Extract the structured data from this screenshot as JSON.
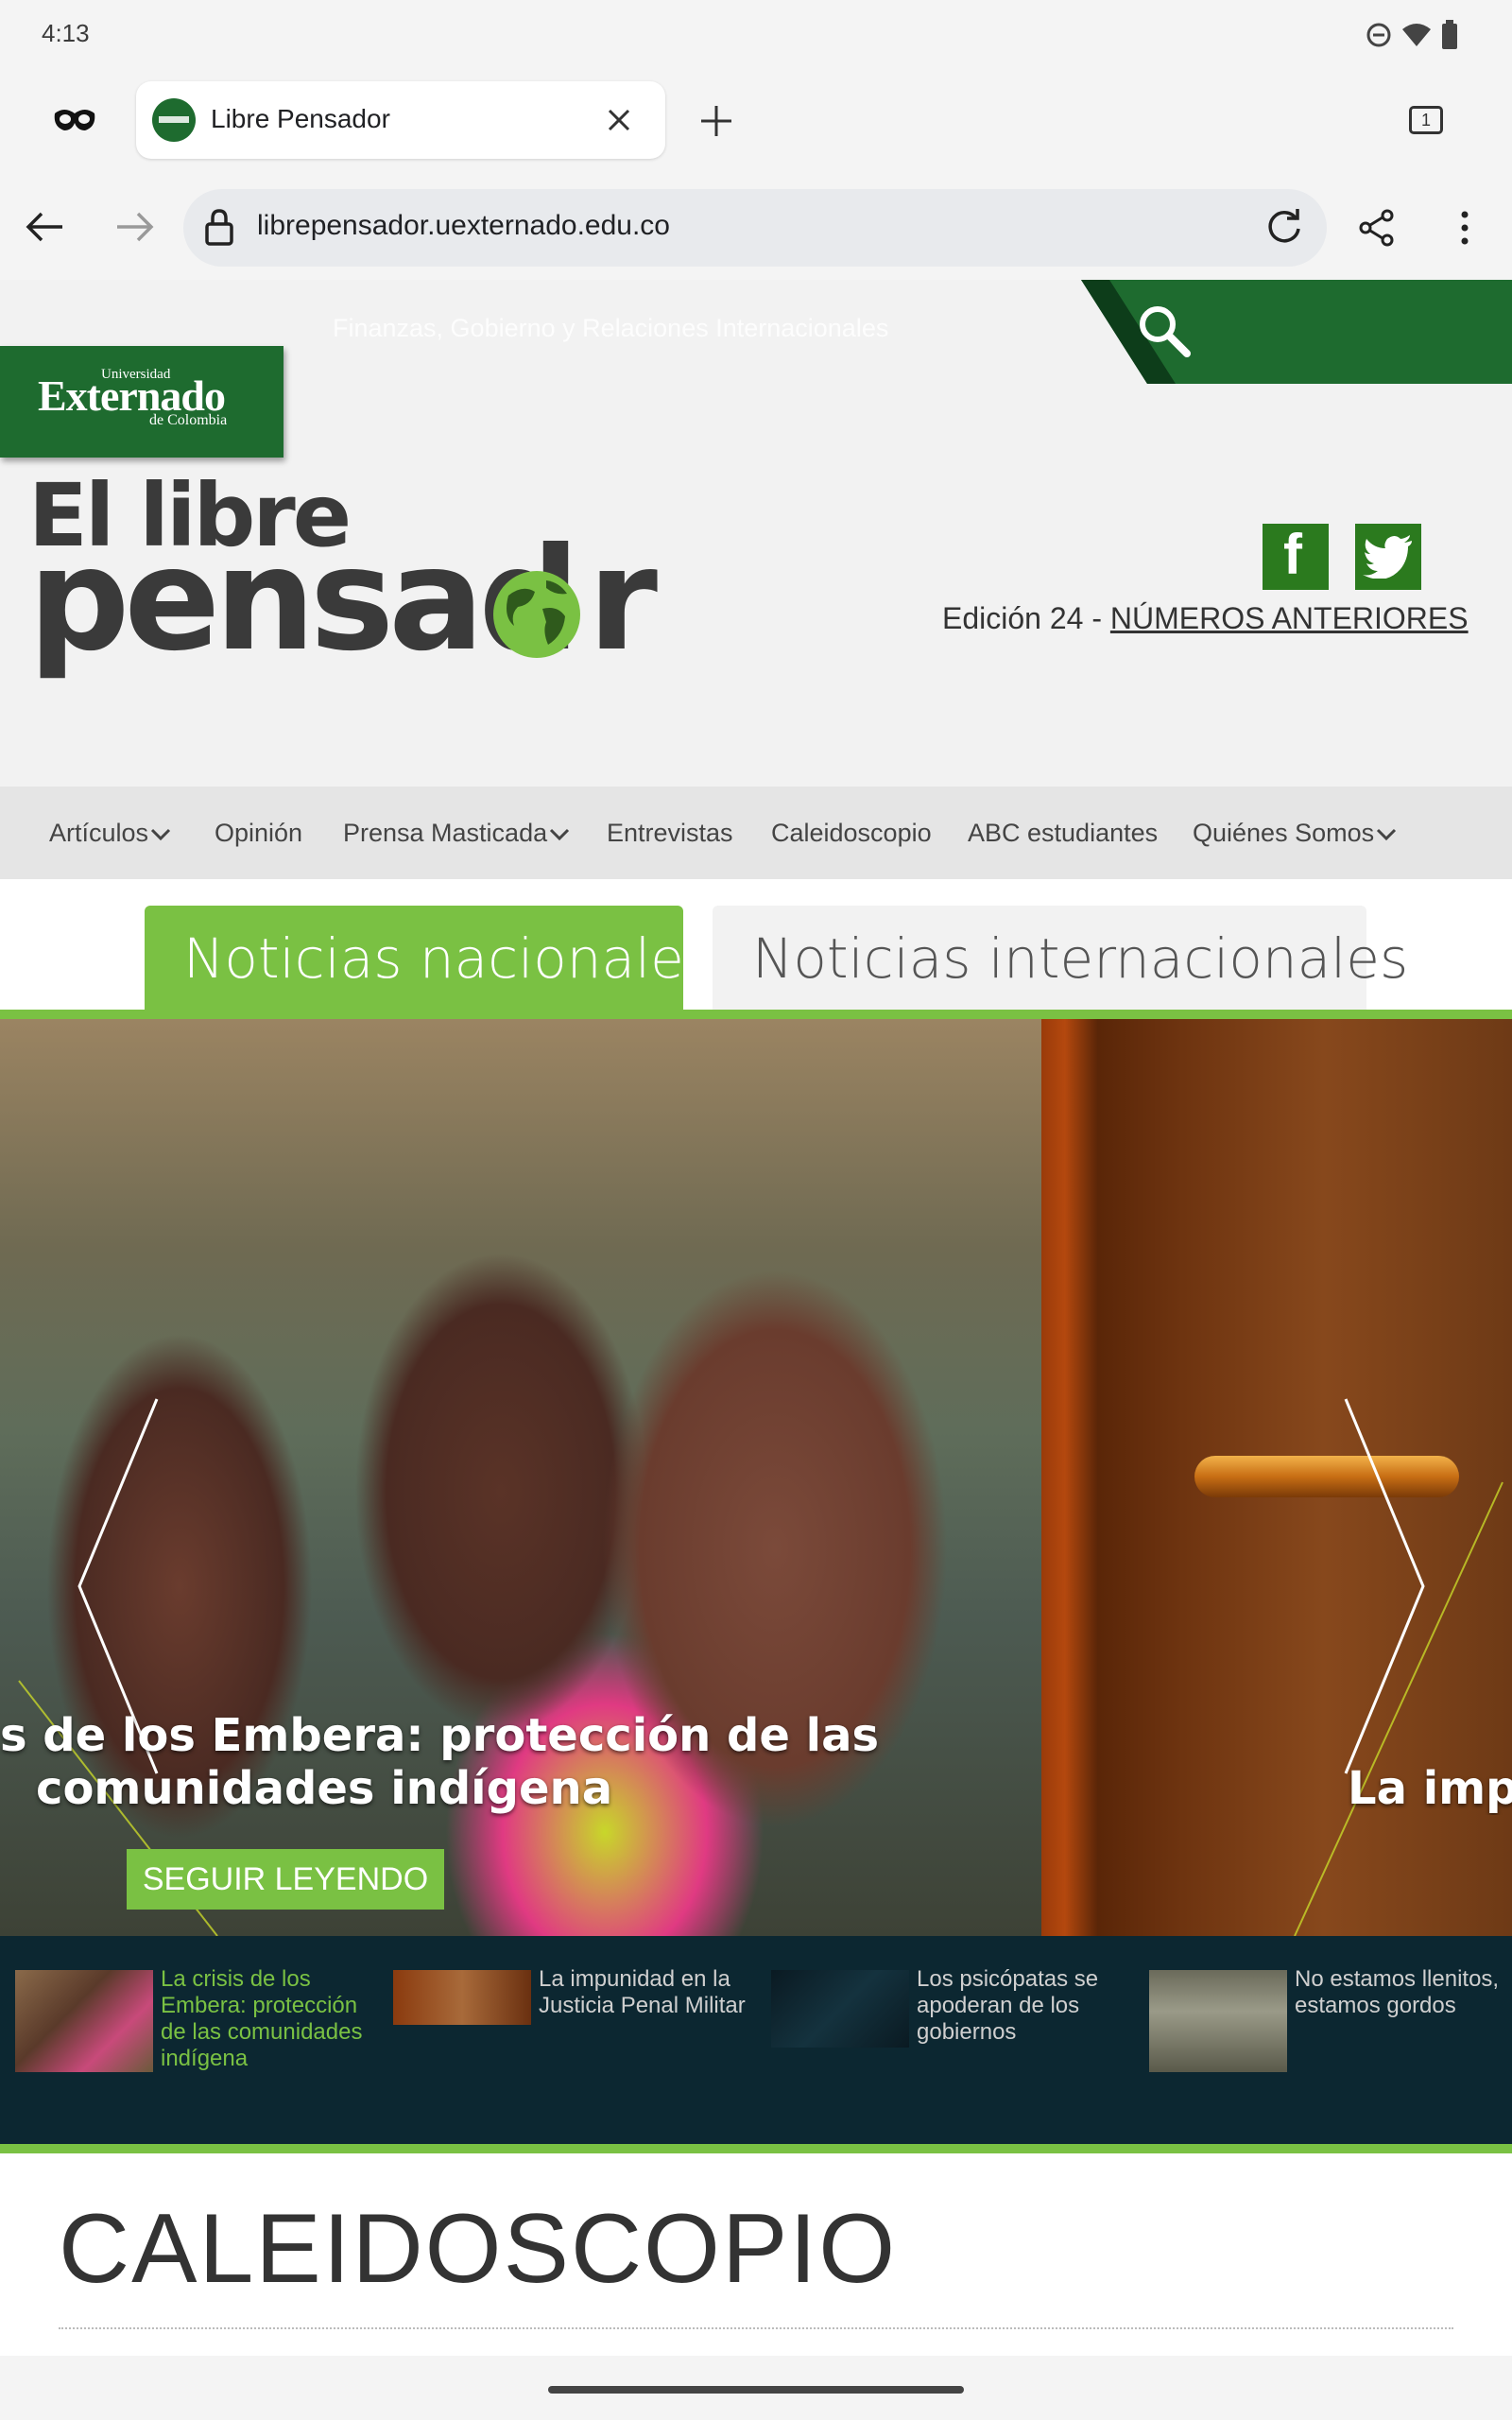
{
  "status": {
    "time": "4:13"
  },
  "browser": {
    "tab_title": "Libre Pensador",
    "tab_count": "1",
    "url": "librepensador.uexternado.edu.co"
  },
  "site": {
    "tagline": "Finanzas, Gobierno y Relaciones Internacionales",
    "logo": {
      "top": "Universidad",
      "main": "Externado",
      "bottom": "de Colombia"
    },
    "title_line1": "El libre",
    "title_line2a": "pensad",
    "title_line2b": "r",
    "edition_prefix": "Edición 24 - ",
    "edition_link": "NÚMEROS ANTERIORES",
    "fb": "f"
  },
  "nav": {
    "items": [
      "Artículos",
      "Opinión",
      "Prensa Masticada",
      "Entrevistas",
      "Caleidoscopio",
      "ABC estudiantes",
      "Quiénes Somos"
    ]
  },
  "tabs": {
    "national": "Noticias nacionales",
    "international": "Noticias internacionales"
  },
  "slider": {
    "title_line1": "s de los Embera: protección de las",
    "title_line2": "comunidades indígena",
    "next_title": "La impu",
    "read_more": "SEGUIR LEYENDO"
  },
  "thumbs": [
    {
      "text": "La crisis de los Embera: protección de las comunidades indígena"
    },
    {
      "text": "La impunidad en la Justicia Penal Militar"
    },
    {
      "text": "Los psicópatas se apoderan de los gobiernos"
    },
    {
      "text": "No estamos llenitos, estamos gordos"
    }
  ],
  "section": {
    "title": "CALEIDOSCOPIO"
  },
  "colors": {
    "green_dark": "#1e6b2f",
    "green_light": "#7ac143",
    "strip_bg": "#0c2731"
  }
}
